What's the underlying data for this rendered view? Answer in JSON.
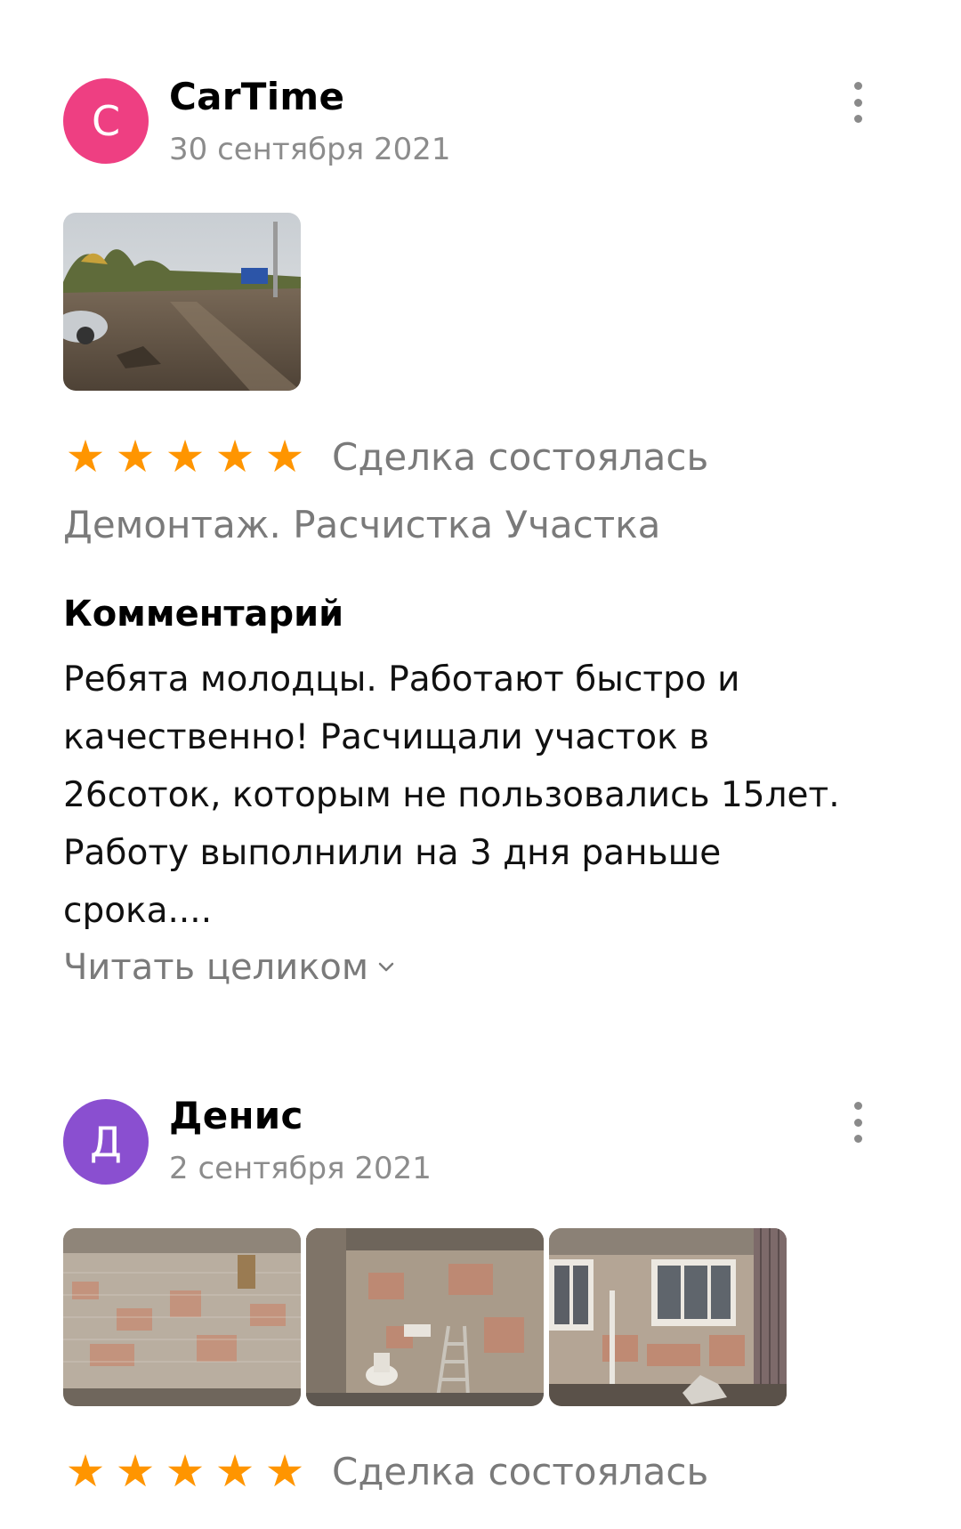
{
  "reviews": [
    {
      "avatar_letter": "C",
      "avatar_color": "#ee3f82",
      "author": "CarTime",
      "date": "30 сентября 2021",
      "photos": [
        "land-clearing-photo"
      ],
      "rating": 5,
      "deal_status": "Сделка состоялась",
      "service": "Демонтаж. Расчистка Участка",
      "comment_title": "Комментарий",
      "comment_lines": [
        "Ребята молодцы. Работают быстро и",
        "качественно! Расчищали участок в",
        "26соток, которым не пользовались 15лет.",
        "Работу выполнили на 3 дня раньше",
        "срока...."
      ],
      "read_more": "Читать целиком"
    },
    {
      "avatar_letter": "Д",
      "avatar_color": "#8a4fd0",
      "author": "Денис",
      "date": "2 сентября 2021",
      "photos": [
        "demolished-wall-photo",
        "bathroom-demolition-photo",
        "room-windows-photo"
      ],
      "rating": 5,
      "deal_status": "Сделка состоялась"
    }
  ],
  "icons": {
    "star": "star-icon",
    "more": "more-vertical-icon",
    "chevron": "chevron-down-icon"
  },
  "colors": {
    "star": "#ff9500",
    "muted_text": "#7a7a7a"
  }
}
